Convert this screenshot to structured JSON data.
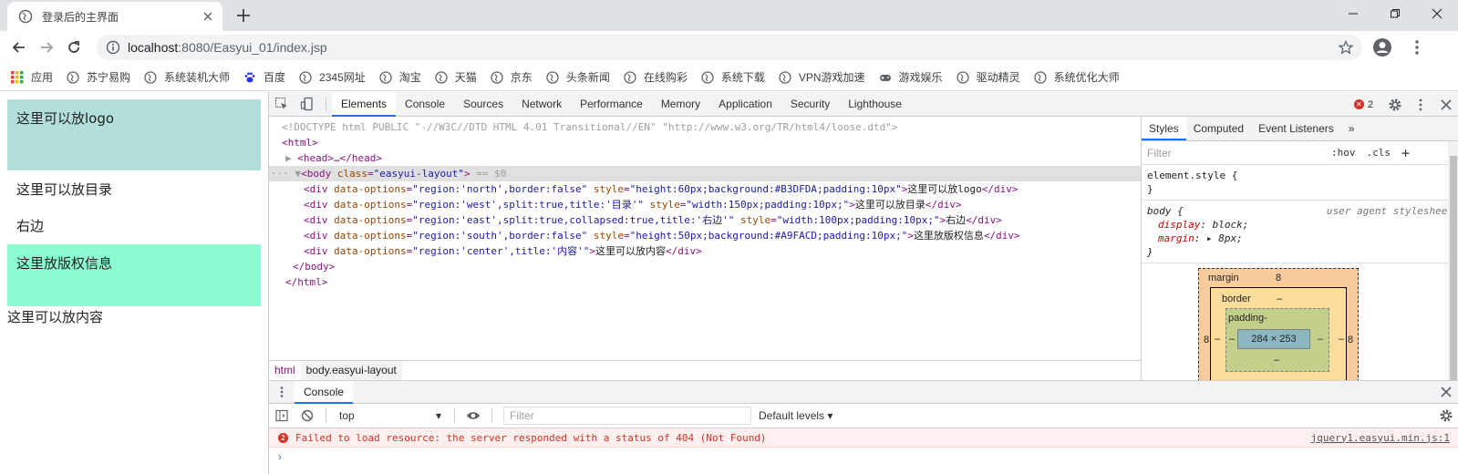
{
  "tab": {
    "title": "登录后的主界面"
  },
  "address": {
    "host": "localhost",
    "path": ":8080/Easyui_01/index.jsp"
  },
  "bookmarks": [
    {
      "label": "应用",
      "icon": "apps-grid-icon"
    },
    {
      "label": "苏宁易购",
      "icon": "globe-icon"
    },
    {
      "label": "系统装机大师",
      "icon": "globe-icon"
    },
    {
      "label": "百度",
      "icon": "baidu-paw-icon"
    },
    {
      "label": "2345网址",
      "icon": "globe-icon"
    },
    {
      "label": "淘宝",
      "icon": "globe-icon"
    },
    {
      "label": "天猫",
      "icon": "globe-icon"
    },
    {
      "label": "京东",
      "icon": "globe-icon"
    },
    {
      "label": "头条新闻",
      "icon": "globe-icon"
    },
    {
      "label": "在线购彩",
      "icon": "globe-icon"
    },
    {
      "label": "系统下载",
      "icon": "globe-icon"
    },
    {
      "label": "VPN游戏加速",
      "icon": "globe-icon"
    },
    {
      "label": "游戏娱乐",
      "icon": "gamepad-icon"
    },
    {
      "label": "驱动精灵",
      "icon": "globe-icon"
    },
    {
      "label": "系统优化大师",
      "icon": "globe-icon"
    }
  ],
  "page": {
    "north": "这里可以放logo",
    "west": "这里可以放目录",
    "east": "右边",
    "south": "这里放版权信息",
    "center": "这里可以放内容",
    "north_bg": "#B3DFDA",
    "south_bg": "#8AFCD0"
  },
  "devtools": {
    "tabs": [
      "Elements",
      "Console",
      "Sources",
      "Network",
      "Performance",
      "Memory",
      "Application",
      "Security",
      "Lighthouse"
    ],
    "error_count": "2",
    "elements": {
      "doctype": "<!DOCTYPE html PUBLIC \"-//W3C//DTD HTML 4.01 Transitional//EN\" \"http://www.w3.org/TR/html4/loose.dtd\">",
      "html_open": "<html>",
      "head": "<head>…</head>",
      "body_open": "<body class=\"easyui-layout\">",
      "body_marker": "== $0",
      "divs": [
        {
          "opts": "region:'north',border:false",
          "style": "height:60px;background:#B3DFDA;padding:10px",
          "text": "这里可以放logo"
        },
        {
          "opts": "region:'west',split:true,title:'目录'",
          "style": "width:150px;padding:10px;",
          "text": "这里可以放目录"
        },
        {
          "opts": "region:'east',split:true,collapsed:true,title:'右边'",
          "style": "width:100px;padding:10px;",
          "text": "右边"
        },
        {
          "opts": "region:'south',border:false",
          "style": "height:50px;background:#A9FACD;padding:10px;",
          "text": "这里放版权信息"
        },
        {
          "opts": "region:'center',title:'内容'",
          "style": null,
          "text": "这里可以放内容"
        }
      ],
      "body_close": "</body>",
      "html_close": "</html>"
    },
    "breadcrumb": [
      "html",
      "body.easyui-layout"
    ],
    "styles": {
      "tabs": [
        "Styles",
        "Computed",
        "Event Listeners",
        "»"
      ],
      "filter_placeholder": "Filter",
      "hov": ":hov",
      "cls": ".cls",
      "element_style": "element.style {",
      "rule_selector": "body {",
      "rule_source": "user agent stylesheet",
      "decls": [
        {
          "prop": "display",
          "val": "block;"
        },
        {
          "prop": "margin",
          "val": "▸ 8px;"
        }
      ],
      "close_brace": "}"
    },
    "boxmodel": {
      "margin_label": "margin",
      "margin_value": "8",
      "border_label": "border",
      "border_value": "–",
      "padding_label": "padding-",
      "content": "284 × 253",
      "dash": "–",
      "side": "8"
    },
    "console": {
      "drawer_tab": "Console",
      "context": "top",
      "filter_placeholder": "Filter",
      "levels": "Default levels ▾",
      "error_count": "2",
      "error_text": "Failed to load resource: the server responded with a status of 404 (Not Found)",
      "error_source": "jquery1.easyui.min.js:1",
      "prompt": "›"
    }
  }
}
